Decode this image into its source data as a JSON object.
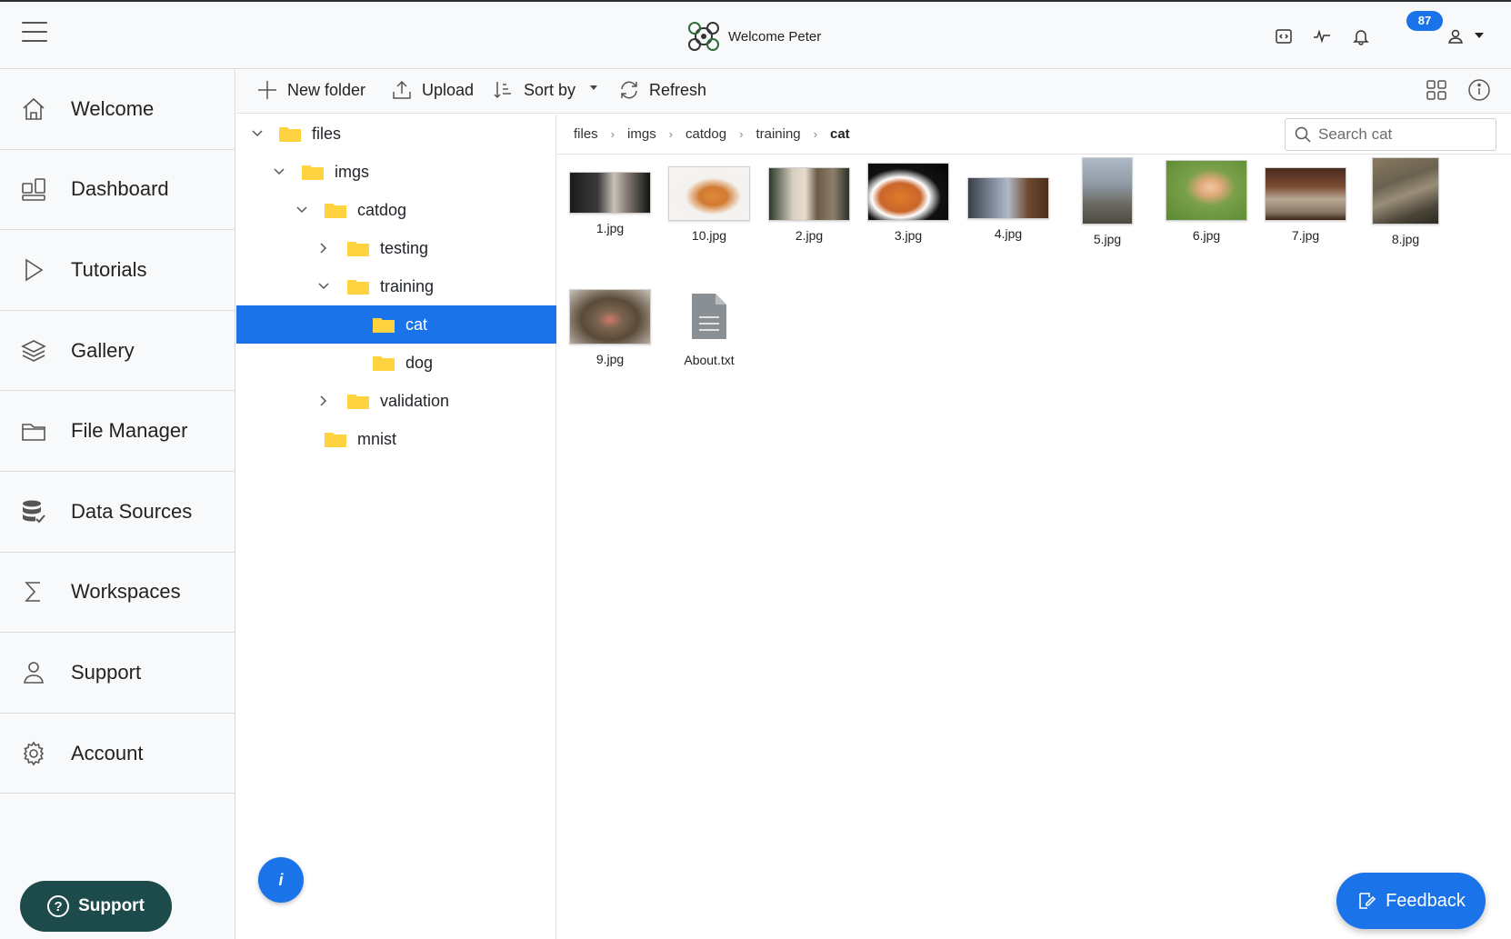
{
  "header": {
    "welcome": "Welcome Peter",
    "notification_count": "87",
    "icons": [
      "code-brackets-icon",
      "activity-icon",
      "bell-icon",
      "user-icon"
    ]
  },
  "sidebar": {
    "items": [
      {
        "label": "Welcome",
        "icon": "home-icon"
      },
      {
        "label": "Dashboard",
        "icon": "dashboard-icon"
      },
      {
        "label": "Tutorials",
        "icon": "play-icon"
      },
      {
        "label": "Gallery",
        "icon": "layers-icon"
      },
      {
        "label": "File Manager",
        "icon": "folder-icon"
      },
      {
        "label": "Data Sources",
        "icon": "database-icon"
      },
      {
        "label": "Workspaces",
        "icon": "sigma-icon"
      },
      {
        "label": "Support",
        "icon": "person-icon"
      },
      {
        "label": "Account",
        "icon": "gear-icon"
      }
    ],
    "support_button": "Support"
  },
  "toolbar": {
    "new_folder": "New folder",
    "upload": "Upload",
    "sort_by": "Sort by",
    "refresh": "Refresh"
  },
  "tree": {
    "nodes": [
      {
        "label": "files",
        "expanded": true
      },
      {
        "label": "imgs",
        "expanded": true
      },
      {
        "label": "catdog",
        "expanded": true
      },
      {
        "label": "testing",
        "expanded": false
      },
      {
        "label": "training",
        "expanded": true
      },
      {
        "label": "cat",
        "selected": true
      },
      {
        "label": "dog"
      },
      {
        "label": "validation",
        "expanded": false
      },
      {
        "label": "mnist"
      }
    ]
  },
  "breadcrumb": [
    "files",
    "imgs",
    "catdog",
    "training",
    "cat"
  ],
  "search": {
    "placeholder": "Search cat"
  },
  "files": [
    {
      "name": "1.jpg"
    },
    {
      "name": "10.jpg"
    },
    {
      "name": "2.jpg"
    },
    {
      "name": "3.jpg"
    },
    {
      "name": "4.jpg"
    },
    {
      "name": "5.jpg"
    },
    {
      "name": "6.jpg"
    },
    {
      "name": "7.jpg"
    },
    {
      "name": "8.jpg"
    },
    {
      "name": "9.jpg"
    },
    {
      "name": "About.txt"
    }
  ],
  "feedback": "Feedback",
  "colors": {
    "accent": "#1a73e8",
    "support_button": "#1d4a4a",
    "folder": "#ffd23f"
  }
}
